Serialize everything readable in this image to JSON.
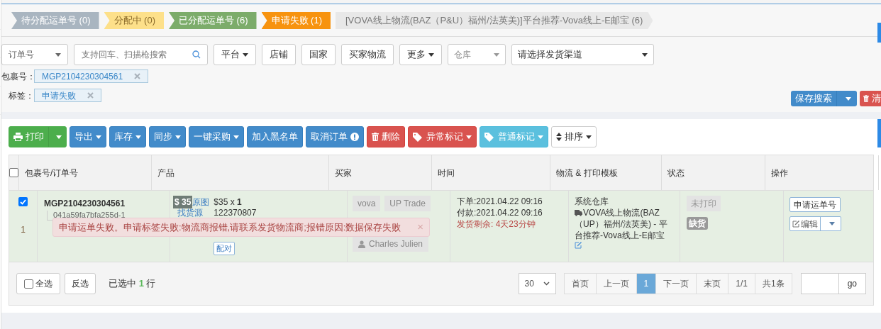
{
  "status_tabs": [
    {
      "label": "待分配运单号 (0)",
      "kind": "muted"
    },
    {
      "label": "分配中 (0)",
      "kind": "warning"
    },
    {
      "label": "已分配运单号 (6)",
      "kind": "success"
    },
    {
      "label": "申请失败 (1)",
      "kind": "danger"
    },
    {
      "label": "[VOVA线上物流(BAZ（P&U）福州/法英美)]平台推荐-Vova线上-E邮宝 (6)",
      "kind": "light"
    }
  ],
  "filters": {
    "order_field": "订单号",
    "search": {
      "placeholder": "支持回车、扫描枪搜索"
    },
    "buttons": [
      {
        "label": "平台",
        "caret": true
      },
      {
        "label": "店铺",
        "caret": false
      },
      {
        "label": "国家",
        "caret": false
      },
      {
        "label": "买家物流",
        "caret": false
      },
      {
        "label": "更多",
        "caret": true
      }
    ],
    "warehouse": {
      "placeholder": "仓库"
    },
    "channel": "请选择发货渠道"
  },
  "active_filters": [
    {
      "label": "包裹号：",
      "value": "MGP2104230304561"
    },
    {
      "label": "标签：",
      "value": "申请失败"
    }
  ],
  "search_actions": {
    "save": "保存搜索",
    "clear": "清"
  },
  "toolbar": [
    {
      "label": "打印",
      "kind": "success",
      "caret": true,
      "split": true
    },
    {
      "label": "导出",
      "kind": "primary",
      "caret": true
    },
    {
      "label": "库存",
      "kind": "primary",
      "caret": true
    },
    {
      "label": "同步",
      "kind": "primary",
      "caret": true
    },
    {
      "label": "一键采购",
      "kind": "primary",
      "caret": true
    },
    {
      "label": "加入黑名单",
      "kind": "primary",
      "caret": false
    },
    {
      "label": "取消订单",
      "kind": "primary",
      "caret": false
    },
    {
      "label": "删除",
      "kind": "danger",
      "caret": false
    },
    {
      "label": "异常标记",
      "kind": "danger",
      "caret": true
    },
    {
      "label": "普通标记",
      "kind": "info",
      "caret": true
    },
    {
      "label": "排序",
      "kind": "default",
      "caret": true
    }
  ],
  "table": {
    "columns": [
      "包裹号/订单号",
      "产品",
      "买家",
      "时间",
      "物流 & 打印模板",
      "状态",
      "操作"
    ],
    "header_checked": false,
    "rows": [
      {
        "checked": true,
        "index": "1",
        "package_no": "MGP2104230304561",
        "order_no": "041a59fa7bfa255d-1",
        "price_badge": "$ 35",
        "image_link": "原图",
        "source_link": "找货源",
        "price": "$35 x ",
        "qty": "1",
        "sku": "122370807",
        "pair": "配对",
        "buyer_tags": [
          "vova",
          "UP Trade"
        ],
        "buyer_name": "Charles Julien",
        "order_time": "下单:2021.04.22 09:16",
        "pay_time": "付款:2021.04.22 09:16",
        "ship_left": "发货剩余: 4天23分钟",
        "warehouse": "系统仓库",
        "logistics": "VOVA线上物流(BAZ（UP）福州/法英美) - 平台推荐-Vova线上-E邮宝",
        "print_status": "未打印",
        "stock_status": "缺货",
        "actions": {
          "apply": "申请运单号",
          "edit": "编辑"
        }
      }
    ]
  },
  "toast": {
    "message": "申请运单失败。申请标签失败:物流商报错,请联系发货物流商;报错原因:数据保存失败",
    "close": "×"
  },
  "footer": {
    "select_all": {
      "label": "全选",
      "checked": false
    },
    "invert": "反选",
    "selected_prefix": "已选中 ",
    "selected_count": "1",
    "selected_suffix": " 行",
    "page_size": "30",
    "pages": [
      {
        "label": "首页",
        "selected": false
      },
      {
        "label": "上一页",
        "selected": false
      },
      {
        "label": "1",
        "selected": true
      },
      {
        "label": "下一页",
        "selected": false
      },
      {
        "label": "末页",
        "selected": false
      },
      {
        "label": "1/1",
        "selected": false
      },
      {
        "label": "共1条",
        "selected": false
      }
    ],
    "go": "go"
  }
}
